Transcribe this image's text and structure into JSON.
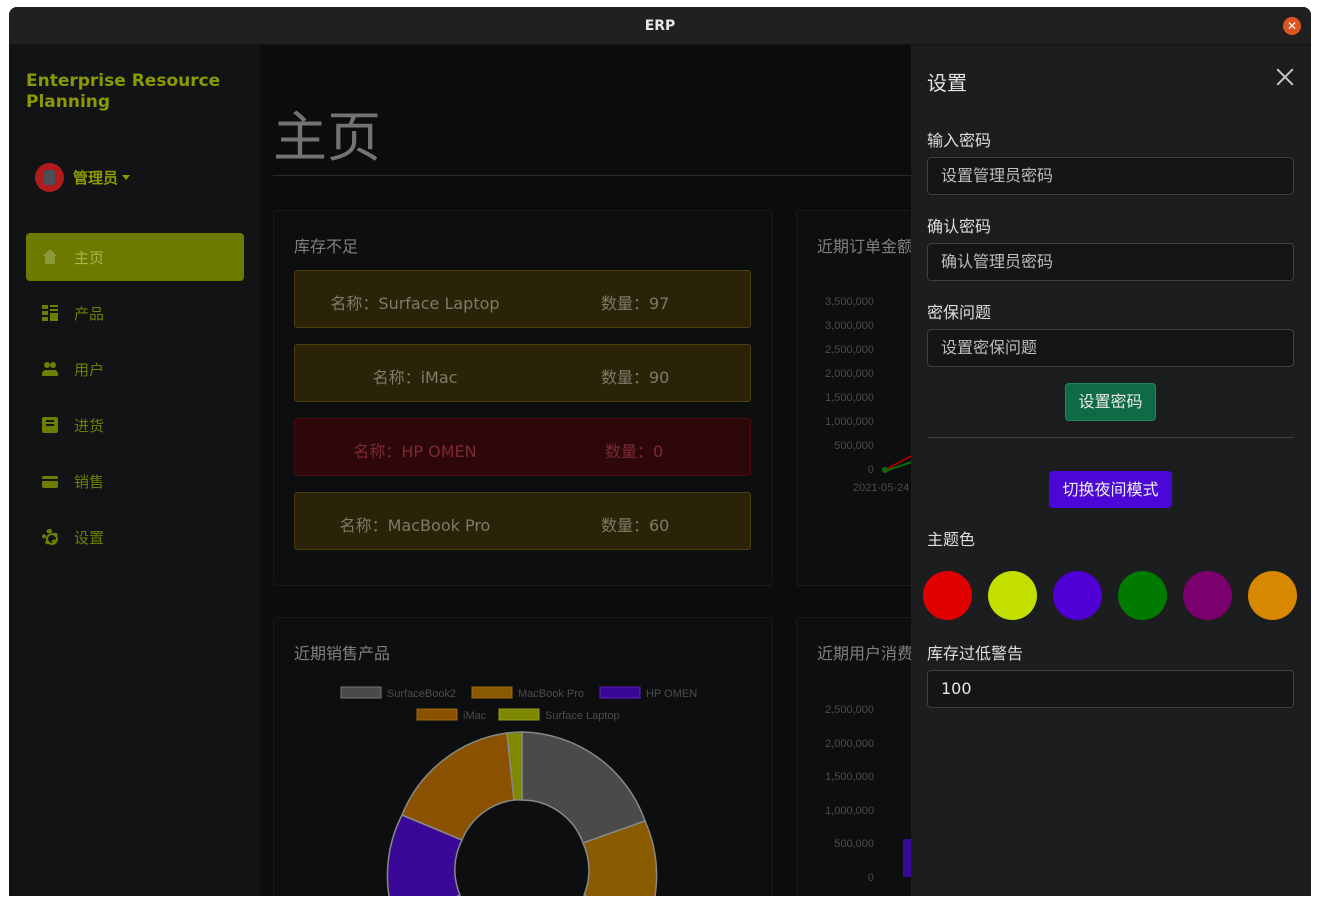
{
  "window": {
    "title": "ERP"
  },
  "sidebar": {
    "brand": "Enterprise Resource Planning",
    "user": "管理员",
    "items": [
      {
        "label": "主页",
        "icon": "home-icon",
        "active": true
      },
      {
        "label": "产品",
        "icon": "grid-icon",
        "active": false
      },
      {
        "label": "用户",
        "icon": "users-icon",
        "active": false
      },
      {
        "label": "进货",
        "icon": "scroll-icon",
        "active": false
      },
      {
        "label": "销售",
        "icon": "card-icon",
        "active": false
      },
      {
        "label": "设置",
        "icon": "gear-icon",
        "active": false
      }
    ]
  },
  "main": {
    "title": "主页",
    "low_stock": {
      "title": "库存不足",
      "items": [
        {
          "name": "名称：Surface Laptop",
          "qty": "数量：97",
          "status": "warning"
        },
        {
          "name": "名称：iMac",
          "qty": "数量：90",
          "status": "warning"
        },
        {
          "name": "名称：HP OMEN",
          "qty": "数量：0",
          "status": "danger"
        },
        {
          "name": "名称：MacBook Pro",
          "qty": "数量：60",
          "status": "warning"
        }
      ]
    },
    "recent_orders": {
      "title": "近期订单金额",
      "y_ticks": [
        "3,500,000",
        "3,000,000",
        "2,500,000",
        "2,000,000",
        "1,500,000",
        "1,000,000",
        "500,000",
        "0"
      ],
      "x_label": "2021-05-24"
    },
    "recent_sales": {
      "title": "近期销售产品",
      "legend": [
        {
          "name": "SurfaceBook2",
          "color": "#4a4a4a"
        },
        {
          "name": "MacBook Pro",
          "color": "#8a5a00"
        },
        {
          "name": "HP OMEN",
          "color": "#3a0896"
        },
        {
          "name": "iMac",
          "color": "#8a5200"
        },
        {
          "name": "Surface Laptop",
          "color": "#7e8800"
        }
      ]
    },
    "recent_users": {
      "title": "近期用户消费",
      "y_ticks": [
        "2,500,000",
        "2,000,000",
        "1,500,000",
        "1,000,000",
        "500,000",
        "0"
      ]
    }
  },
  "settings": {
    "title": "设置",
    "password_label": "输入密码",
    "password_placeholder": "设置管理员密码",
    "confirm_label": "确认密码",
    "confirm_placeholder": "确认管理员密码",
    "question_label": "密保问题",
    "question_placeholder": "设置密保问题",
    "set_password_button": "设置密码",
    "night_mode_button": "切换夜间模式",
    "theme_label": "主题色",
    "theme_colors": [
      "#e00000",
      "#c2df00",
      "#5000d4",
      "#007a00",
      "#7a006e",
      "#d88800"
    ],
    "low_stock_label": "库存过低警告",
    "low_stock_value": "100"
  }
}
